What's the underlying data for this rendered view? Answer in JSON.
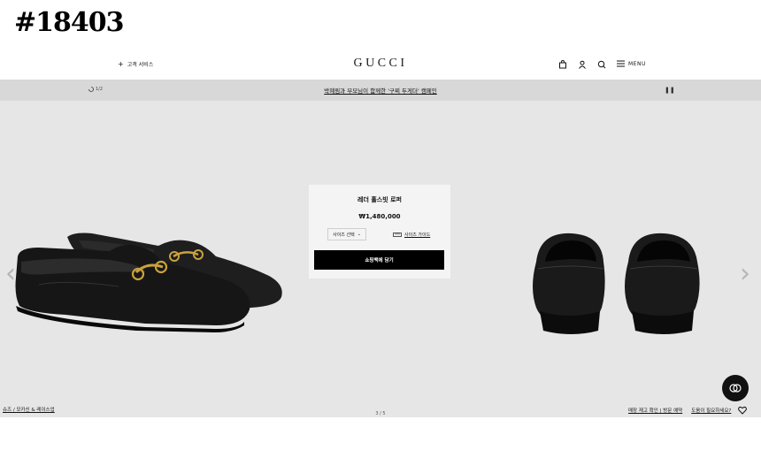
{
  "overlay_tag": "#18403",
  "header": {
    "customer_service_label": "고객 서비스",
    "logo_text": "GUCCI",
    "menu_label": "MENU"
  },
  "promo": {
    "counter": "1/2",
    "message": "박혜림과 부모님이 함께한 '구찌 두게더' 캠페인"
  },
  "product": {
    "name": "레더 홀스빗 로퍼",
    "price": "₩1,480,000",
    "size_select_label": "사이즈 선택",
    "size_guide_label": "사이즈 가이드",
    "add_to_bag_label": "쇼핑백에 담기"
  },
  "breadcrumb": "슈즈 / 모카신 & 레이스업",
  "pager": "3 / 5",
  "footer_links": {
    "stock_check": "매장 재고 확인 | 방문 예약",
    "help": "도움이 필요하세요?"
  },
  "colors": {
    "hero_bg": "#e6e6e6",
    "promo_bg": "#d8d8d8",
    "button_bg": "#000000",
    "accent_gold": "#c9a23c"
  }
}
